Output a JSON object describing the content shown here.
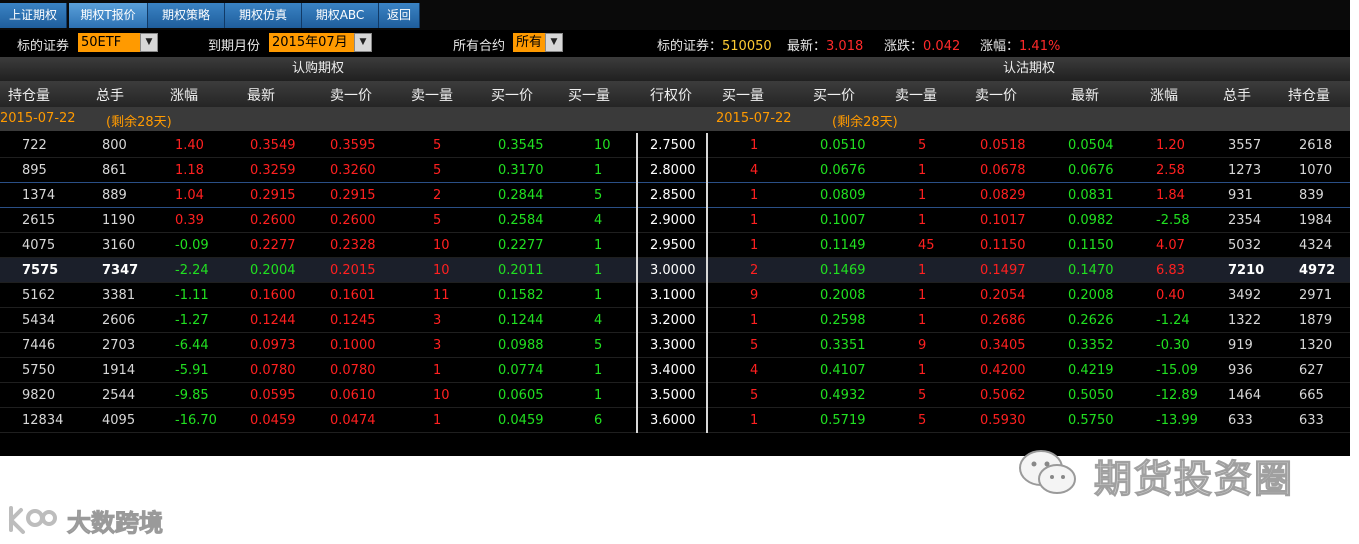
{
  "tabs": [
    "上证期权",
    "期权T报价",
    "期权策略",
    "期权仿真",
    "期权ABC",
    "返回"
  ],
  "filters": {
    "underlying_label": "标的证券",
    "underlying_value": "50ETF",
    "expiry_label": "到期月份",
    "expiry_value": "2015年07月",
    "contract_label": "所有合约",
    "contract_value": "所有"
  },
  "summary": {
    "underlying_label": "标的证券：",
    "underlying_code": "510050",
    "latest_label": "最新：",
    "latest_value": "3.018",
    "change_label": "涨跌：",
    "change_value": "0.042",
    "pct_label": "涨幅：",
    "pct_value": "1.41%"
  },
  "groups": {
    "call": "认购期权",
    "put": "认沽期权"
  },
  "columns": {
    "call": [
      "持仓量",
      "总手",
      "涨幅",
      "最新",
      "卖一价",
      "卖一量",
      "买一价",
      "买一量"
    ],
    "strike": "行权价",
    "put": [
      "买一量",
      "买一价",
      "卖一量",
      "卖一价",
      "最新",
      "涨幅",
      "总手",
      "持仓量"
    ]
  },
  "expiry_row": {
    "call_date": "2015-07-22",
    "call_remaining": "(剩余28天)",
    "put_date": "2015-07-22",
    "put_remaining": "(剩余28天)"
  },
  "rows": [
    {
      "call": [
        "722",
        "800",
        "1.40",
        "0.3549",
        "0.3595",
        "5",
        "0.3545",
        "10"
      ],
      "strike": "2.7500",
      "put": [
        "1",
        "0.0510",
        "5",
        "0.0518",
        "0.0504",
        "1.20",
        "3557",
        "2618"
      ]
    },
    {
      "call": [
        "895",
        "861",
        "1.18",
        "0.3259",
        "0.3260",
        "5",
        "0.3170",
        "1"
      ],
      "strike": "2.8000",
      "put": [
        "4",
        "0.0676",
        "1",
        "0.0678",
        "0.0676",
        "2.58",
        "1273",
        "1070"
      ]
    },
    {
      "call": [
        "1374",
        "889",
        "1.04",
        "0.2915",
        "0.2915",
        "2",
        "0.2844",
        "5"
      ],
      "strike": "2.8500",
      "put": [
        "1",
        "0.0809",
        "1",
        "0.0829",
        "0.0831",
        "1.84",
        "931",
        "839"
      ]
    },
    {
      "call": [
        "2615",
        "1190",
        "0.39",
        "0.2600",
        "0.2600",
        "5",
        "0.2584",
        "4"
      ],
      "strike": "2.9000",
      "put": [
        "1",
        "0.1007",
        "1",
        "0.1017",
        "0.0982",
        "-2.58",
        "2354",
        "1984"
      ]
    },
    {
      "call": [
        "4075",
        "3160",
        "-0.09",
        "0.2277",
        "0.2328",
        "10",
        "0.2277",
        "1"
      ],
      "strike": "2.9500",
      "put": [
        "1",
        "0.1149",
        "45",
        "0.1150",
        "0.1150",
        "4.07",
        "5032",
        "4324"
      ]
    },
    {
      "call": [
        "7575",
        "7347",
        "-2.24",
        "0.2004",
        "0.2015",
        "10",
        "0.2011",
        "1"
      ],
      "strike": "3.0000",
      "put": [
        "2",
        "0.1469",
        "1",
        "0.1497",
        "0.1470",
        "6.83",
        "7210",
        "4972"
      ]
    },
    {
      "call": [
        "5162",
        "3381",
        "-1.11",
        "0.1600",
        "0.1601",
        "11",
        "0.1582",
        "1"
      ],
      "strike": "3.1000",
      "put": [
        "9",
        "0.2008",
        "1",
        "0.2054",
        "0.2008",
        "0.40",
        "3492",
        "2971"
      ]
    },
    {
      "call": [
        "5434",
        "2606",
        "-1.27",
        "0.1244",
        "0.1245",
        "3",
        "0.1244",
        "4"
      ],
      "strike": "3.2000",
      "put": [
        "1",
        "0.2598",
        "1",
        "0.2686",
        "0.2626",
        "-1.24",
        "1322",
        "1879"
      ]
    },
    {
      "call": [
        "7446",
        "2703",
        "-6.44",
        "0.0973",
        "0.1000",
        "3",
        "0.0988",
        "5"
      ],
      "strike": "3.3000",
      "put": [
        "5",
        "0.3351",
        "9",
        "0.3405",
        "0.3352",
        "-0.30",
        "919",
        "1320"
      ]
    },
    {
      "call": [
        "5750",
        "1914",
        "-5.91",
        "0.0780",
        "0.0780",
        "1",
        "0.0774",
        "1"
      ],
      "strike": "3.4000",
      "put": [
        "4",
        "0.4107",
        "1",
        "0.4200",
        "0.4219",
        "-15.09",
        "936",
        "627"
      ]
    },
    {
      "call": [
        "9820",
        "2544",
        "-9.85",
        "0.0595",
        "0.0610",
        "10",
        "0.0605",
        "1"
      ],
      "strike": "3.5000",
      "put": [
        "5",
        "0.4932",
        "5",
        "0.5062",
        "0.5050",
        "-12.89",
        "1464",
        "665"
      ]
    },
    {
      "call": [
        "12834",
        "4095",
        "-16.70",
        "0.0459",
        "0.0474",
        "1",
        "0.0459",
        "6"
      ],
      "strike": "3.6000",
      "put": [
        "1",
        "0.5719",
        "5",
        "0.5930",
        "0.5750",
        "-13.99",
        "633",
        "633"
      ]
    }
  ],
  "colors": {
    "up": "#ff2020",
    "down": "#21e021",
    "neutral": "#d8d8d8",
    "accent": "#ff9a00",
    "background": "#000000"
  },
  "watermarks": {
    "wechat_text": "期货投资圈",
    "wechat_icon": "wechat-icon",
    "brand_text": "大数跨境",
    "brand_icon": "brand-logo-icon"
  }
}
